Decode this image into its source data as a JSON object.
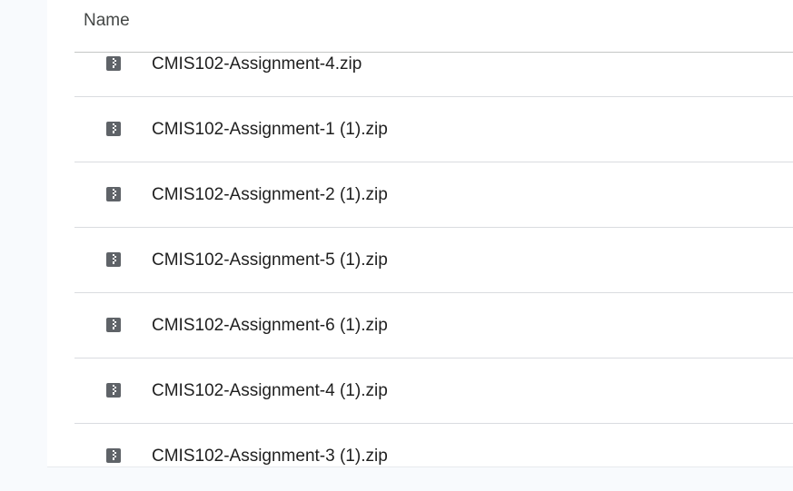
{
  "header": {
    "name_label": "Name"
  },
  "files": [
    {
      "name": "CMIS102-Assignment-4.zip",
      "icon": "zip-file-icon"
    },
    {
      "name": "CMIS102-Assignment-1 (1).zip",
      "icon": "zip-file-icon"
    },
    {
      "name": "CMIS102-Assignment-2 (1).zip",
      "icon": "zip-file-icon"
    },
    {
      "name": "CMIS102-Assignment-5 (1).zip",
      "icon": "zip-file-icon"
    },
    {
      "name": "CMIS102-Assignment-6 (1).zip",
      "icon": "zip-file-icon"
    },
    {
      "name": "CMIS102-Assignment-4 (1).zip",
      "icon": "zip-file-icon"
    },
    {
      "name": "CMIS102-Assignment-3 (1).zip",
      "icon": "zip-file-icon"
    }
  ],
  "colors": {
    "icon": "#5f6368",
    "text": "#1f1f1f",
    "header_text": "#444746",
    "divider": "#dadce0",
    "background": "#f8fafd"
  }
}
